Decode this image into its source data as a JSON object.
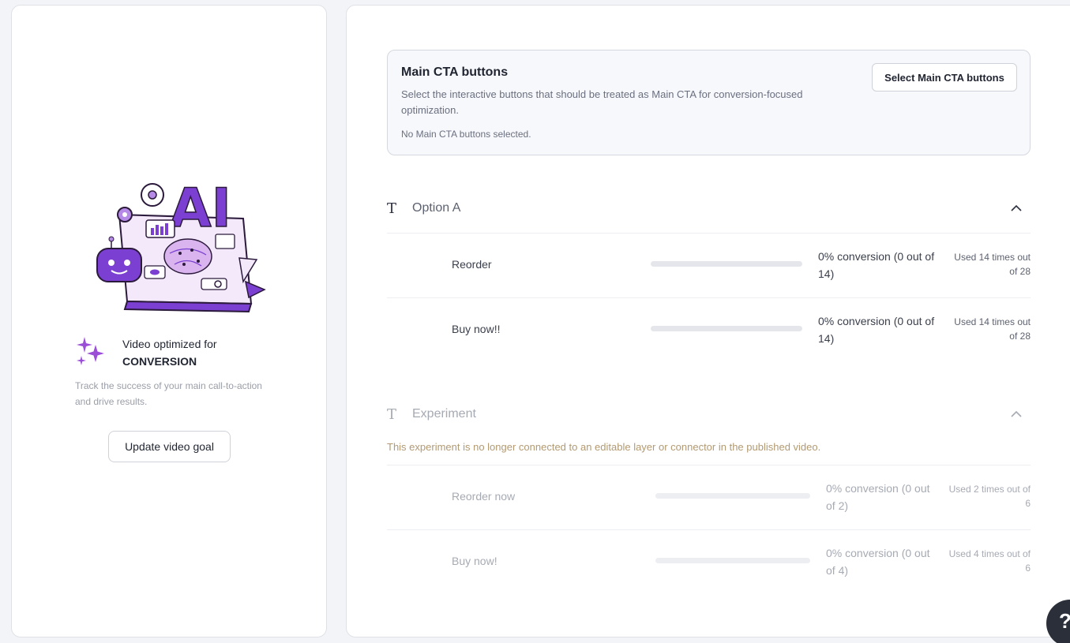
{
  "left": {
    "goal_line1": "Video optimized for",
    "goal_line2": "CONVERSION",
    "description": "Track the success of your main call-to-action and drive results.",
    "update_button": "Update video goal",
    "illustration_text": "AI"
  },
  "cta": {
    "title": "Main CTA buttons",
    "description": "Select the interactive buttons that should be treated as Main CTA for conversion-focused optimization.",
    "note": "No Main CTA buttons selected.",
    "select_button": "Select Main CTA buttons"
  },
  "sections": [
    {
      "title": "Option A",
      "rows": [
        {
          "label": "Reorder",
          "conversion": "0% conversion (0 out of 14)",
          "used": "Used 14 times out of 28",
          "fill": 0
        },
        {
          "label": "Buy now!!",
          "conversion": "0% conversion (0 out of 14)",
          "used": "Used 14 times out of 28",
          "fill": 0
        }
      ]
    },
    {
      "title": "Experiment",
      "warning": "This experiment is no longer connected to an editable layer or connector in the published video.",
      "rows": [
        {
          "label": "Reorder now",
          "conversion": "0% conversion (0 out of 2)",
          "used": "Used 2 times out of 6",
          "fill": 0
        },
        {
          "label": "Buy now!",
          "conversion": "0% conversion (0 out of 4)",
          "used": "Used 4 times out of 6",
          "fill": 0
        }
      ]
    }
  ],
  "icons": {
    "section_type": "text-type-icon",
    "collapse": "chevron-up-icon",
    "sparkles": "sparkles-icon",
    "help": "help-icon"
  },
  "help_glyph": "?",
  "colors": {
    "accent_purple": "#7b3fd1",
    "warning_text": "#b29a72"
  }
}
